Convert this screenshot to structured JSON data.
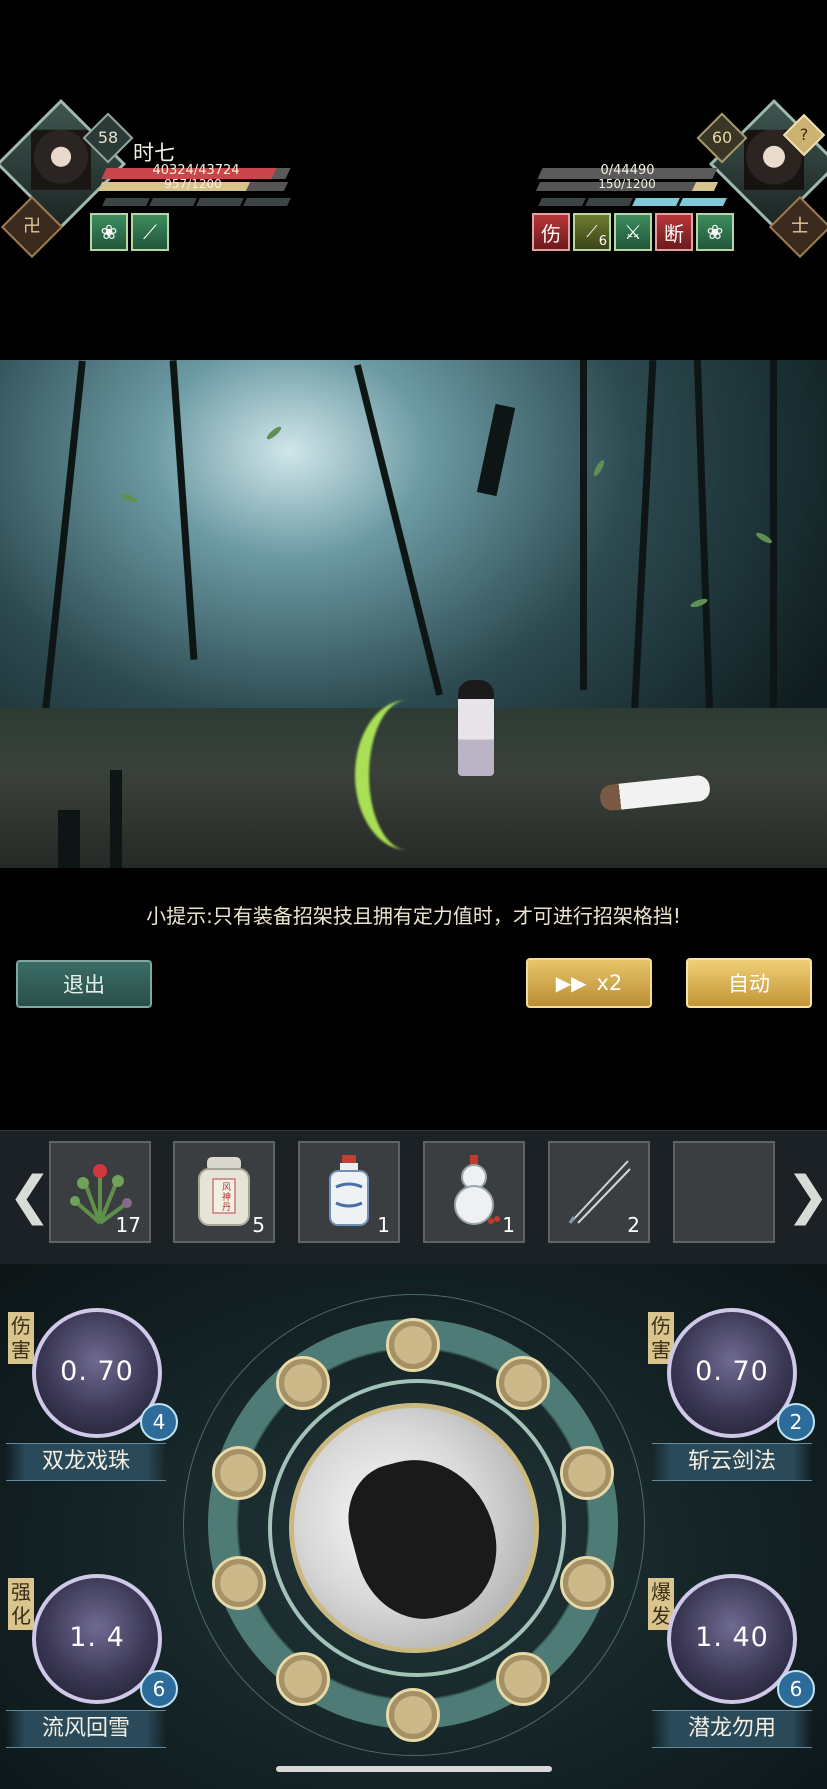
{
  "player": {
    "name": "时七",
    "level": "58",
    "hp_text": "40324/43724",
    "hp_fraction": 0.922,
    "mp_text": "957/1200",
    "mp_fraction": 0.7975,
    "buffs": [
      {
        "icon": "lotus-icon",
        "color": "#3e8d5f"
      },
      {
        "icon": "sword-icon",
        "color": "#3e8d5f"
      }
    ]
  },
  "enemy": {
    "level": "60",
    "hp_text": "0/44490",
    "hp_fraction": 0,
    "mp_text": "150/1200",
    "mp_fraction": 0.125,
    "help": "?",
    "badge": "士",
    "buffs": [
      {
        "label": "伤",
        "color": "#b8373a"
      },
      {
        "label": "6",
        "icon": "sword-icon",
        "color": "#6f7d31"
      },
      {
        "label": "",
        "icon": "blade-icon",
        "color": "#3e8d5f"
      },
      {
        "label": "断",
        "color": "#b8373a"
      },
      {
        "label": "",
        "icon": "lotus-icon",
        "color": "#3e8d5f"
      }
    ]
  },
  "player_badge": "卍",
  "tip": "小提示:只有装备招架技且拥有定力值时，才可进行招架格挡!",
  "controls": {
    "exit": "退出",
    "speed": "x2",
    "auto": "自动"
  },
  "items": [
    {
      "icon": "herb-icon",
      "count": "17"
    },
    {
      "icon": "pill-bottle-icon",
      "count": "5",
      "label": "风神丹"
    },
    {
      "icon": "porcelain-bottle-icon",
      "count": "1"
    },
    {
      "icon": "gourd-icon",
      "count": "1"
    },
    {
      "icon": "needle-icon",
      "count": "2"
    },
    {
      "icon": "",
      "count": ""
    }
  ],
  "skills": [
    {
      "name": "双龙戏珠",
      "multiplier": "0. 70",
      "count": "4",
      "tag": "伤害"
    },
    {
      "name": "斩云剑法",
      "multiplier": "0. 70",
      "count": "2",
      "tag": "伤害"
    },
    {
      "name": "流风回雪",
      "multiplier": "1. 4",
      "count": "6",
      "tag": "强化"
    },
    {
      "name": "潜龙勿用",
      "multiplier": "1. 40",
      "count": "6",
      "tag": "爆发"
    }
  ],
  "colors": {
    "hp": "#c9474a",
    "mp": "#d6c48d",
    "accent_gold": "#e9c56a",
    "accent_teal": "#3b6c66"
  }
}
